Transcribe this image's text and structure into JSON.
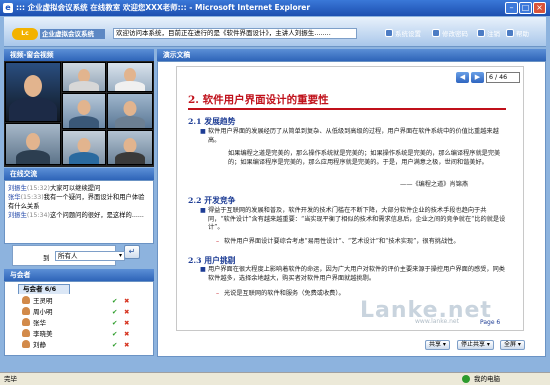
{
  "window": {
    "title": "::: 企业虚拟会议系统  在线教室  欢迎您XXX老师::: - Microsoft Internet Explorer"
  },
  "header": {
    "logo_text": "Lc",
    "system_name": "企业虚拟会议系统",
    "marquee": "欢迎访问本系统，目前正在进行的是《软件界面设计》，主讲人刘振生........",
    "nav": [
      {
        "label": "系统设置"
      },
      {
        "label": "修改密码"
      },
      {
        "label": "注销"
      },
      {
        "label": "帮助"
      }
    ]
  },
  "video_panel": {
    "title": "视频-窗会视频"
  },
  "chat_panel": {
    "title": "在线交流",
    "messages": [
      {
        "name": "刘振生",
        "time": "(15:32)",
        "text": "大家可以继续提问"
      },
      {
        "name": "张华",
        "time": "(15:33)",
        "text": "我有一个疑问，界面设计和用户体验有什么关系"
      },
      {
        "name": "刘振生",
        "time": "(15:34)",
        "text": "这个问题问的很好，是这样的......"
      }
    ],
    "to_label": "到",
    "to_value": "所有人",
    "send_icon": "return-arrow-icon"
  },
  "attendees_panel": {
    "title": "与会者",
    "tab": "与会者  6/6",
    "people": [
      {
        "name": "王灵明"
      },
      {
        "name": "周小明"
      },
      {
        "name": "张华"
      },
      {
        "name": "李晓美"
      },
      {
        "name": "刘静"
      }
    ]
  },
  "document_panel": {
    "title": "演示文稿",
    "page_input": "6",
    "page_total": "/ 46",
    "slide": {
      "title": "2. 软件用户界面设计的重要性",
      "sections": [
        {
          "heading": "2.1 发展趋势",
          "bullet": "软件用户界面的发展经历了从简单到复杂、从低级到高级的过程，用户界面在软件系统中的价值比重越来越高。",
          "quote": "如果编程之道是完美的，那么操作系统就是完美的；如果操作系统是完美的，那么编译程序就是完美的；如果编译程序是完美的，那么应用程序就是完美的。于是，用户满意之极，世间和谐美好。",
          "cite": "——《编程之道》肖锦燕"
        },
        {
          "heading": "2.2 开发竞争",
          "bullet": "得益于互联网的发展和普及，软件开发的技术门槛在不断下降，大部分软件企业的技术手段也趋向于共同，“软件设计”含有越来越重要：“当实现平衡了相似的技术和需求信息后，企业之间的竞争就在“比的就是设计”。",
          "dash": "软件用户界面设计要综合考虑“易用性设计”、“艺术设计”和“技术实现”，很有挑战性。"
        },
        {
          "heading": "2.3 用户挑剔",
          "bullet": "用户界面在很大程度上影响着软件的命运，因为广大用户对软件的评价主要来源于操控用户界面的感受，同类软件越多，选择余地越大，购买者对软件用户界面就越挑剔。",
          "dash": "光说是互联网的软件和服务（免费或收费）。"
        }
      ],
      "watermark": "Lanke.net",
      "watermark_url": "www.lanke.net",
      "page_label": "Page 6"
    },
    "toolbar": {
      "share": "共享",
      "stop_share": "停止共享",
      "fullscreen": "全屏"
    }
  },
  "statusbar": {
    "left": "完毕",
    "right": "我的电脑"
  }
}
